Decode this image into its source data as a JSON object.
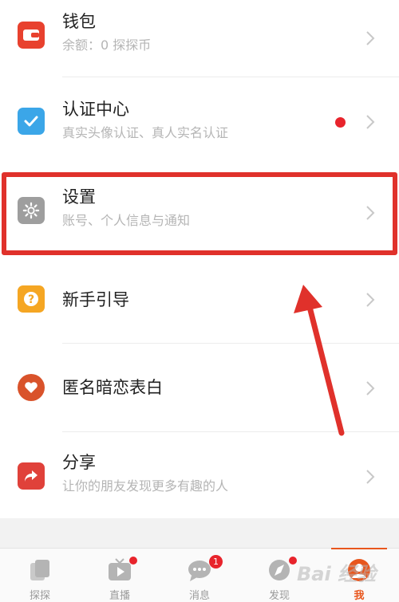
{
  "menu": {
    "wallet": {
      "title": "钱包",
      "subtitle": "余额：0 探探币"
    },
    "verify": {
      "title": "认证中心",
      "subtitle": "真实头像认证、真人实名认证"
    },
    "settings": {
      "title": "设置",
      "subtitle": "账号、个人信息与通知"
    },
    "guide": {
      "title": "新手引导"
    },
    "anonymous": {
      "title": "匿名暗恋表白"
    },
    "share": {
      "title": "分享",
      "subtitle": "让你的朋友发现更多有趣的人"
    }
  },
  "tabbar": {
    "tabs": [
      {
        "label": "探探"
      },
      {
        "label": "直播"
      },
      {
        "label": "消息",
        "badge": "1"
      },
      {
        "label": "发现"
      },
      {
        "label": "我"
      }
    ]
  },
  "watermark": "Bai 经验",
  "colors": {
    "accent": "#e8561d",
    "highlight": "#e0312b",
    "wallet_icon": "#e8412e",
    "verify_icon": "#3ba6e8",
    "settings_icon": "#9e9e9e",
    "guide_icon": "#f5a623",
    "anonymous_icon": "#d9532b",
    "share_icon": "#e0413a"
  }
}
